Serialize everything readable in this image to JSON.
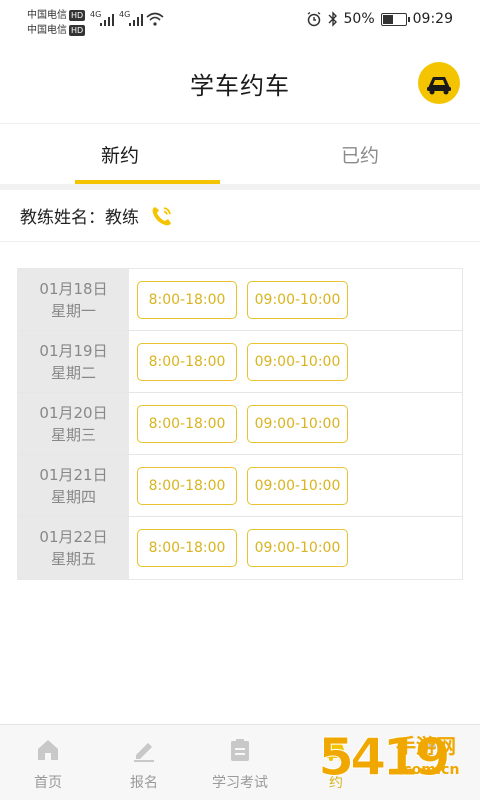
{
  "status_bar": {
    "carrier1": "中国电信",
    "carrier2": "中国电信",
    "hd": "HD",
    "net1": "4G",
    "net2": "4G",
    "battery_text": "50%",
    "battery_level": 0.5,
    "time": "09:29"
  },
  "header": {
    "title": "学车约车",
    "icon": "car-wheel-icon"
  },
  "tabs": [
    {
      "label": "新约",
      "active": true
    },
    {
      "label": "已约",
      "active": false
    }
  ],
  "coach": {
    "label": "教练姓名：",
    "name": "教练",
    "icon": "phone-icon"
  },
  "schedule": [
    {
      "date": "01月18日",
      "weekday": "星期一",
      "slots": [
        "8:00-18:00",
        "09:00-10:00"
      ]
    },
    {
      "date": "01月19日",
      "weekday": "星期二",
      "slots": [
        "8:00-18:00",
        "09:00-10:00"
      ]
    },
    {
      "date": "01月20日",
      "weekday": "星期三",
      "slots": [
        "8:00-18:00",
        "09:00-10:00"
      ]
    },
    {
      "date": "01月21日",
      "weekday": "星期四",
      "slots": [
        "8:00-18:00",
        "09:00-10:00"
      ]
    },
    {
      "date": "01月22日",
      "weekday": "星期五",
      "slots": [
        "8:00-18:00",
        "09:00-10:00"
      ]
    }
  ],
  "bottom_nav": [
    {
      "label": "首页",
      "icon": "home-icon",
      "active": false
    },
    {
      "label": "报名",
      "icon": "edit-icon",
      "active": false
    },
    {
      "label": "学习考试",
      "icon": "clipboard-icon",
      "active": false
    },
    {
      "label": "约",
      "icon": "car-icon",
      "active": true
    },
    {
      "label": "",
      "icon": "user-icon",
      "active": false
    }
  ],
  "watermark": {
    "number": "5419",
    "text": "手游网",
    "url": ".com.cn"
  },
  "colors": {
    "accent": "#f5c400",
    "slot_border": "#e8c230",
    "date_bg": "#e9e9e9"
  }
}
